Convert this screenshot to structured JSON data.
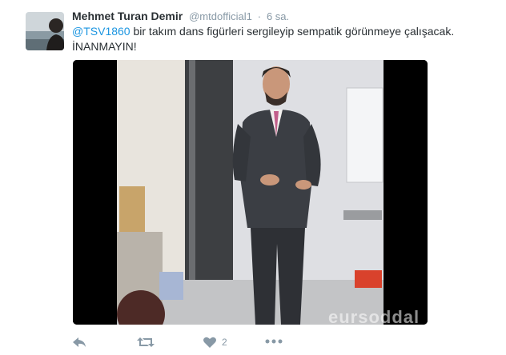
{
  "tweet": {
    "author_name": "Mehmet Turan Demir",
    "handle": "@mtdofficial1",
    "separator": "·",
    "time": "6 sa.",
    "mention": "@TSV1860",
    "text_rest": " bir takım dans figürleri sergileyip sempatik görünmeye çalışacak.",
    "text_line2": "İNANMAYIN!"
  },
  "media": {
    "watermark": "eursoddal"
  },
  "actions": {
    "like_count": "2"
  },
  "icons": {
    "reply": "reply-icon",
    "retweet": "retweet-icon",
    "like": "heart-icon",
    "more": "more-icon"
  },
  "colors": {
    "link": "#1b95e0",
    "muted": "#8899a6",
    "text": "#292f33"
  }
}
